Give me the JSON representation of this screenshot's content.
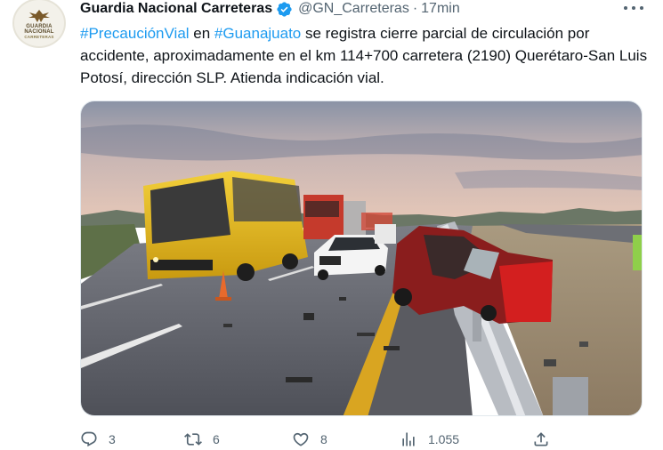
{
  "account": {
    "display_name": "Guardia Nacional Carreteras",
    "handle": "@GN_Carreteras",
    "separator": "·",
    "time": "17min",
    "logo_line1": "GUARDIA",
    "logo_line2": "NACIONAL",
    "logo_line3": "CARRETERAS"
  },
  "tweet": {
    "hashtag1": "#PrecauciónVial",
    "text1": " en ",
    "hashtag2": "#Guanajuato",
    "text2": " se registra cierre parcial de circulación por accidente, aproximadamente en el km 114+700 carretera (2190) Querétaro-San Luis Potosí, dirección SLP. Atienda indicación vial."
  },
  "actions": {
    "replies": "3",
    "retweets": "6",
    "likes": "8",
    "views": "1.055"
  },
  "colors": {
    "link": "#1d9bf0",
    "secondary": "#536471",
    "verified": "#1d9bf0"
  }
}
